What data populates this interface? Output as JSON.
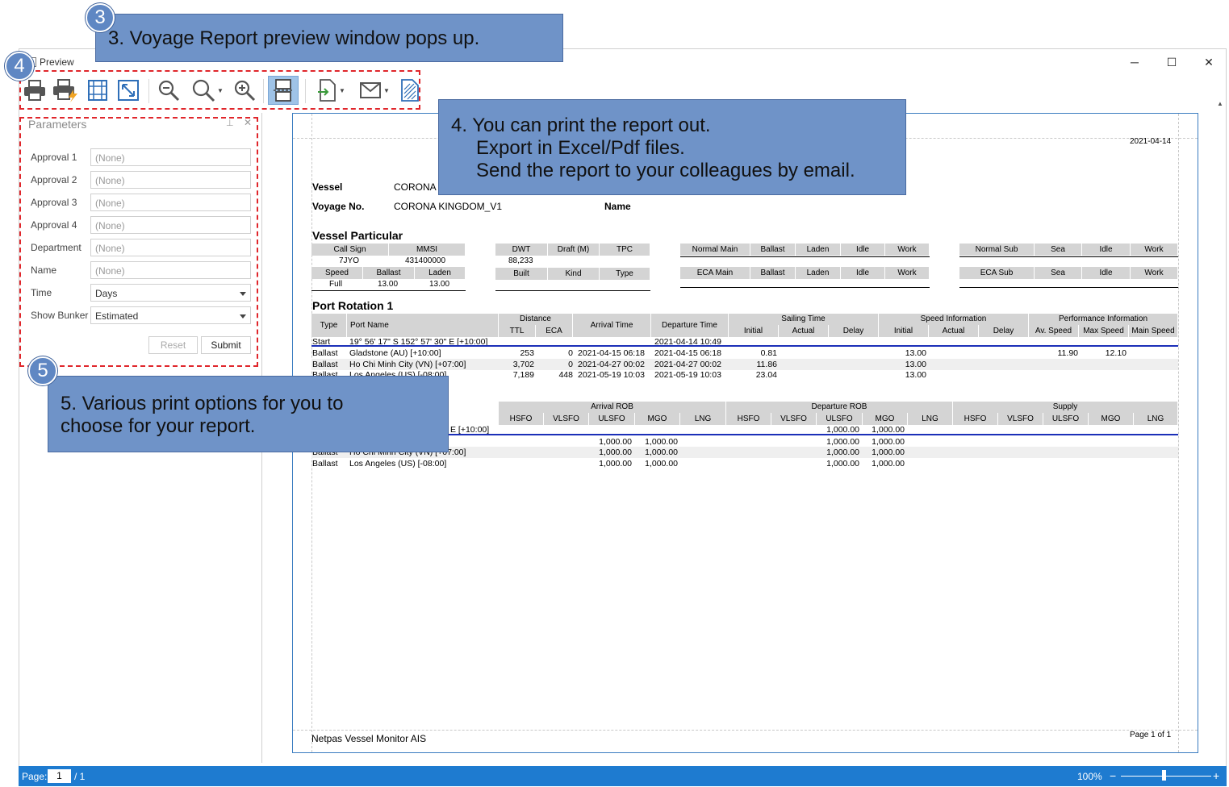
{
  "window": {
    "title": "Preview",
    "minimize": "─",
    "maximize": "☐",
    "close": "✕"
  },
  "callouts": {
    "c3": {
      "badge": "3",
      "text": "3. Voyage Report preview window pops up."
    },
    "c4": {
      "badge": "4",
      "line1": "4. You can print the report out.",
      "line2": "Export in Excel/Pdf files.",
      "line3": "Send the report to your colleagues by email."
    },
    "c5": {
      "badge": "5",
      "text": "5. Various print options for you to choose for your report."
    }
  },
  "toolbar": {
    "icons": [
      "printer-icon",
      "quick-print-icon",
      "page-setup-icon",
      "fit-page-icon",
      "zoom-out-icon",
      "zoom-icon",
      "zoom-in-icon",
      "multi-page-icon",
      "export-icon",
      "email-icon",
      "watermark-icon"
    ]
  },
  "parameters": {
    "title": "Parameters",
    "fields": [
      {
        "label": "Approval 1",
        "value": "(None)"
      },
      {
        "label": "Approval 2",
        "value": "(None)"
      },
      {
        "label": "Approval 3",
        "value": "(None)"
      },
      {
        "label": "Approval 4",
        "value": "(None)"
      },
      {
        "label": "Department",
        "value": "(None)"
      },
      {
        "label": "Name",
        "value": "(None)"
      }
    ],
    "time": {
      "label": "Time",
      "value": "Days"
    },
    "bunker": {
      "label": "Show Bunker",
      "value": "Estimated"
    },
    "reset": "Reset",
    "submit": "Submit"
  },
  "report": {
    "date": "2021-04-14",
    "vessel_label": "Vessel",
    "vessel_value": "CORONA",
    "voyage_label": "Voyage No.",
    "voyage_value": "CORONA KINGDOM_V1",
    "name_label": "Name",
    "particular_title": "Vessel Particular",
    "vp": {
      "call_sign_h": "Call Sign",
      "mmsi_h": "MMSI",
      "call_sign": "7JYO",
      "mmsi": "431400000",
      "speed_h": "Speed",
      "ballast_h": "Ballast",
      "laden_h": "Laden",
      "speed": "Full",
      "ballast": "13.00",
      "laden": "13.00",
      "dwt_h": "DWT",
      "draft_h": "Draft (M)",
      "tpc_h": "TPC",
      "dwt": "88,233",
      "built_h": "Built",
      "kind_h": "Kind",
      "type_h": "Type",
      "normal_main_h": "Normal Main",
      "eca_main_h": "ECA Main",
      "normal_sub_h": "Normal Sub",
      "eca_sub_h": "ECA Sub",
      "ballast2_h": "Ballast",
      "laden2_h": "Laden",
      "idle_h": "Idle",
      "work_h": "Work",
      "sea_h": "Sea"
    },
    "rotation_title": "Port Rotation 1",
    "rot_headers": {
      "type": "Type",
      "port": "Port Name",
      "distance": "Distance",
      "ttl": "TTL",
      "eca": "ECA",
      "arrival": "Arrival Time",
      "departure": "Departure Time",
      "sailing": "Sailing Time",
      "initial": "Initial",
      "actual": "Actual",
      "delay": "Delay",
      "speed_info": "Speed Information",
      "perf": "Performance Information",
      "av_speed": "Av. Speed",
      "max_speed": "Max Speed",
      "main_speed": "Main Speed"
    },
    "rotation": [
      {
        "type": "Start",
        "port": "19° 56' 17\" S 152° 57' 30\" E [+10:00]",
        "ttl": "",
        "eca": "",
        "arr": "",
        "dep": "2021-04-14 10:49",
        "init": "",
        "sp": "",
        "av": "",
        "mx": ""
      },
      {
        "type": "Ballast",
        "port": "Gladstone (AU) [+10:00]",
        "ttl": "253",
        "eca": "0",
        "arr": "2021-04-15 06:18",
        "dep": "2021-04-15 06:18",
        "init": "0.81",
        "sp": "13.00",
        "av": "11.90",
        "mx": "12.10"
      },
      {
        "type": "Ballast",
        "port": "Ho Chi Minh City (VN) [+07:00]",
        "ttl": "3,702",
        "eca": "0",
        "arr": "2021-04-27 00:02",
        "dep": "2021-04-27 00:02",
        "init": "11.86",
        "sp": "13.00",
        "av": "",
        "mx": ""
      },
      {
        "type": "Ballast",
        "port": "Los Angeles (US) [-08:00]",
        "ttl": "7,189",
        "eca": "448",
        "arr": "2021-05-19 10:03",
        "dep": "2021-05-19 10:03",
        "init": "23.04",
        "sp": "13.00",
        "av": "",
        "mx": ""
      }
    ],
    "rob_headers": {
      "arrival": "Arrival ROB",
      "departure": "Departure ROB",
      "supply": "Supply",
      "fuels": [
        "HSFO",
        "VLSFO",
        "ULSFO",
        "MGO",
        "LNG"
      ]
    },
    "rob": [
      {
        "type": "",
        "port": "E [+10:00]",
        "a_ulsfo": "",
        "a_mgo": "",
        "d_ulsfo": "1,000.00",
        "d_mgo": "1,000.00"
      },
      {
        "type": "",
        "port": "",
        "a_ulsfo": "1,000.00",
        "a_mgo": "1,000.00",
        "d_ulsfo": "1,000.00",
        "d_mgo": "1,000.00"
      },
      {
        "type": "Ballast",
        "port": "Ho Chi Minh City (VN) [+07:00]",
        "a_ulsfo": "1,000.00",
        "a_mgo": "1,000.00",
        "d_ulsfo": "1,000.00",
        "d_mgo": "1,000.00"
      },
      {
        "type": "Ballast",
        "port": "Los Angeles (US) [-08:00]",
        "a_ulsfo": "1,000.00",
        "a_mgo": "1,000.00",
        "d_ulsfo": "1,000.00",
        "d_mgo": "1,000.00"
      }
    ],
    "footer_left": "Netpas Vessel Monitor AIS",
    "footer_right": "Page 1 of 1"
  },
  "status": {
    "page_label": "Page:",
    "page_value": "1",
    "page_total": "/ 1",
    "zoom": "100%"
  }
}
